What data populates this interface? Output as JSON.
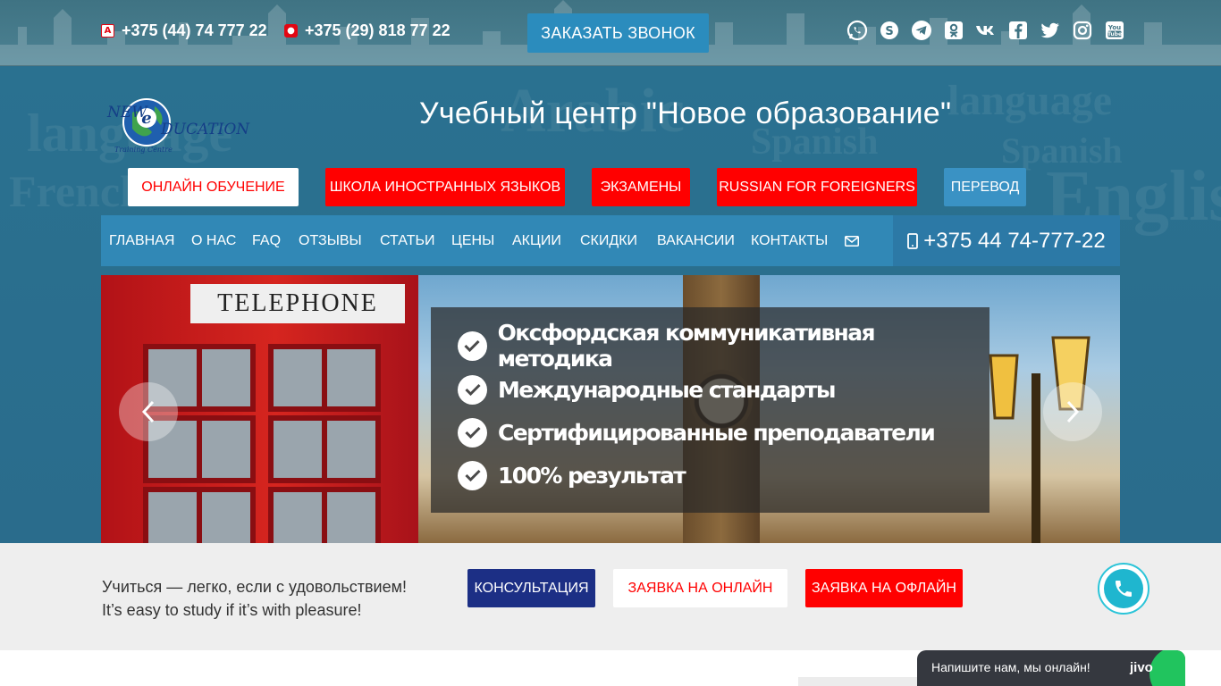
{
  "topbar": {
    "phone_a1": "+375 (44) 74 777 22",
    "phone_mts": "+375 (29) 818 77 22",
    "call_button": "ЗАКАЗАТЬ ЗВОНОК",
    "socials": [
      "whatsapp-icon",
      "skype-icon",
      "telegram-icon",
      "odnoklassniki-icon",
      "vk-icon",
      "facebook-icon",
      "twitter-icon",
      "instagram-icon",
      "youtube-icon"
    ]
  },
  "header": {
    "logo_line1": "NEW",
    "logo_line2": "DUCATION",
    "logo_sub": "Training Centre",
    "title": "Учебный центр \"Новое образование\""
  },
  "categories": [
    {
      "label": "ОНЛАЙН ОБУЧЕНИЕ",
      "color": "#ffffff"
    },
    {
      "label": "ШКОЛА ИНОСТРАННЫХ ЯЗЫКОВ",
      "color": "#ff0000"
    },
    {
      "label": "ЭКЗАМЕНЫ",
      "color": "#ff0000"
    },
    {
      "label": "RUSSIAN FOR FOREIGNERS",
      "color": "#ff0000"
    },
    {
      "label": "ПЕРЕВОД",
      "color": "#3a92c4"
    }
  ],
  "nav": {
    "items": [
      "ГЛАВНАЯ",
      "О НАС",
      "FAQ",
      "ОТЗЫВЫ",
      "СТАТЬИ",
      "ЦЕНЫ",
      "АКЦИИ",
      "СКИДКИ",
      "ВАКАНСИИ",
      "КОНТАКТЫ"
    ],
    "mail_icon": "envelope-icon",
    "phone": "+375 44 74-777-22"
  },
  "slider": {
    "booth_sign": "TELEPHONE",
    "features": [
      "Оксфордская коммуникативная методика",
      "Международные стандарты",
      "Сертифицированные преподаватели",
      "100% результат"
    ]
  },
  "band": {
    "motto_ru": "Учиться — легко, если с удовольствием!",
    "motto_en": "It’s easy to study if it’s with pleasure!",
    "btn_consult": "КОНСУЛЬТАЦИЯ",
    "btn_online": "ЗАЯВКА НА ОНЛАЙН",
    "btn_offline": "ЗАЯВКА НА ОФЛАЙН"
  },
  "jivo": {
    "text": "Напишите нам, мы онлайн!",
    "logo": "jivo"
  },
  "colors": {
    "red": "#ff0000",
    "nav_blue": "#3188b6",
    "dark_navy": "#1c2f85",
    "teal": "#1fb6cf"
  }
}
